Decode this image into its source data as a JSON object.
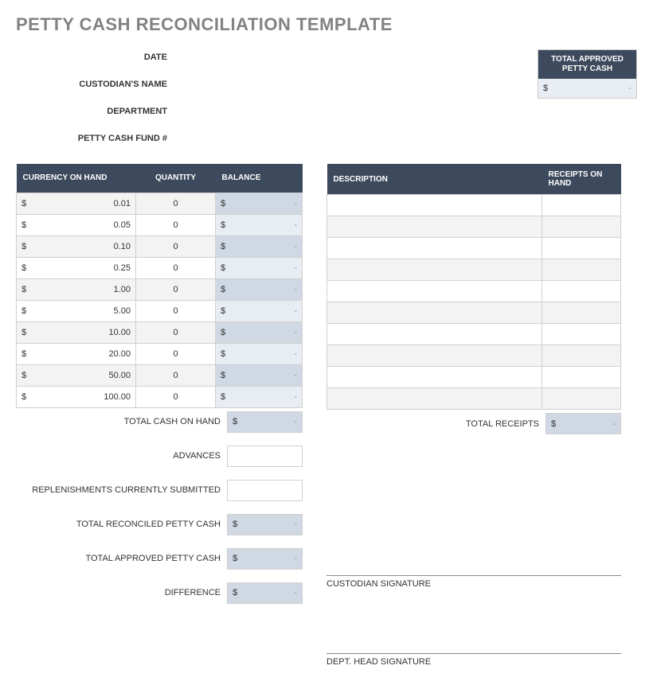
{
  "title": "PETTY CASH RECONCILIATION TEMPLATE",
  "details": {
    "date": "DATE",
    "custodian": "CUSTODIAN'S NAME",
    "department": "DEPARTMENT",
    "fund": "PETTY CASH FUND #"
  },
  "approved_box": {
    "header": "TOTAL APPROVED PETTY CASH",
    "symbol": "$",
    "value": "-"
  },
  "currency_table": {
    "headers": {
      "c0": "CURRENCY ON HAND",
      "c1": "QUANTITY",
      "c2": "BALANCE"
    },
    "rows": [
      {
        "sym": "$",
        "amt": "0.01",
        "qty": "0",
        "bsym": "$",
        "bval": "-"
      },
      {
        "sym": "$",
        "amt": "0.05",
        "qty": "0",
        "bsym": "$",
        "bval": "-"
      },
      {
        "sym": "$",
        "amt": "0.10",
        "qty": "0",
        "bsym": "$",
        "bval": "-"
      },
      {
        "sym": "$",
        "amt": "0.25",
        "qty": "0",
        "bsym": "$",
        "bval": "-"
      },
      {
        "sym": "$",
        "amt": "1.00",
        "qty": "0",
        "bsym": "$",
        "bval": "-"
      },
      {
        "sym": "$",
        "amt": "5.00",
        "qty": "0",
        "bsym": "$",
        "bval": "-"
      },
      {
        "sym": "$",
        "amt": "10.00",
        "qty": "0",
        "bsym": "$",
        "bval": "-"
      },
      {
        "sym": "$",
        "amt": "20.00",
        "qty": "0",
        "bsym": "$",
        "bval": "-"
      },
      {
        "sym": "$",
        "amt": "50.00",
        "qty": "0",
        "bsym": "$",
        "bval": "-"
      },
      {
        "sym": "$",
        "amt": "100.00",
        "qty": "0",
        "bsym": "$",
        "bval": "-"
      }
    ]
  },
  "receipts_table": {
    "headers": {
      "c0": "DESCRIPTION",
      "c1": "RECEIPTS ON HAND"
    },
    "row_count": 10
  },
  "left_totals": {
    "total_cash": {
      "label": "TOTAL CASH ON HAND",
      "sym": "$",
      "val": "-"
    },
    "advances": {
      "label": "ADVANCES"
    },
    "replenishments": {
      "label": "REPLENISHMENTS CURRENTLY SUBMITTED"
    },
    "reconciled": {
      "label": "TOTAL RECONCILED PETTY CASH",
      "sym": "$",
      "val": "-"
    },
    "approved": {
      "label": "TOTAL APPROVED PETTY CASH",
      "sym": "$",
      "val": "-"
    },
    "difference": {
      "label": "DIFFERENCE",
      "sym": "$",
      "val": "-"
    }
  },
  "right_totals": {
    "total_receipts": {
      "label": "TOTAL RECEIPTS",
      "sym": "$",
      "val": "-"
    }
  },
  "signatures": {
    "custodian": "CUSTODIAN SIGNATURE",
    "dept_head": "DEPT. HEAD SIGNATURE"
  }
}
